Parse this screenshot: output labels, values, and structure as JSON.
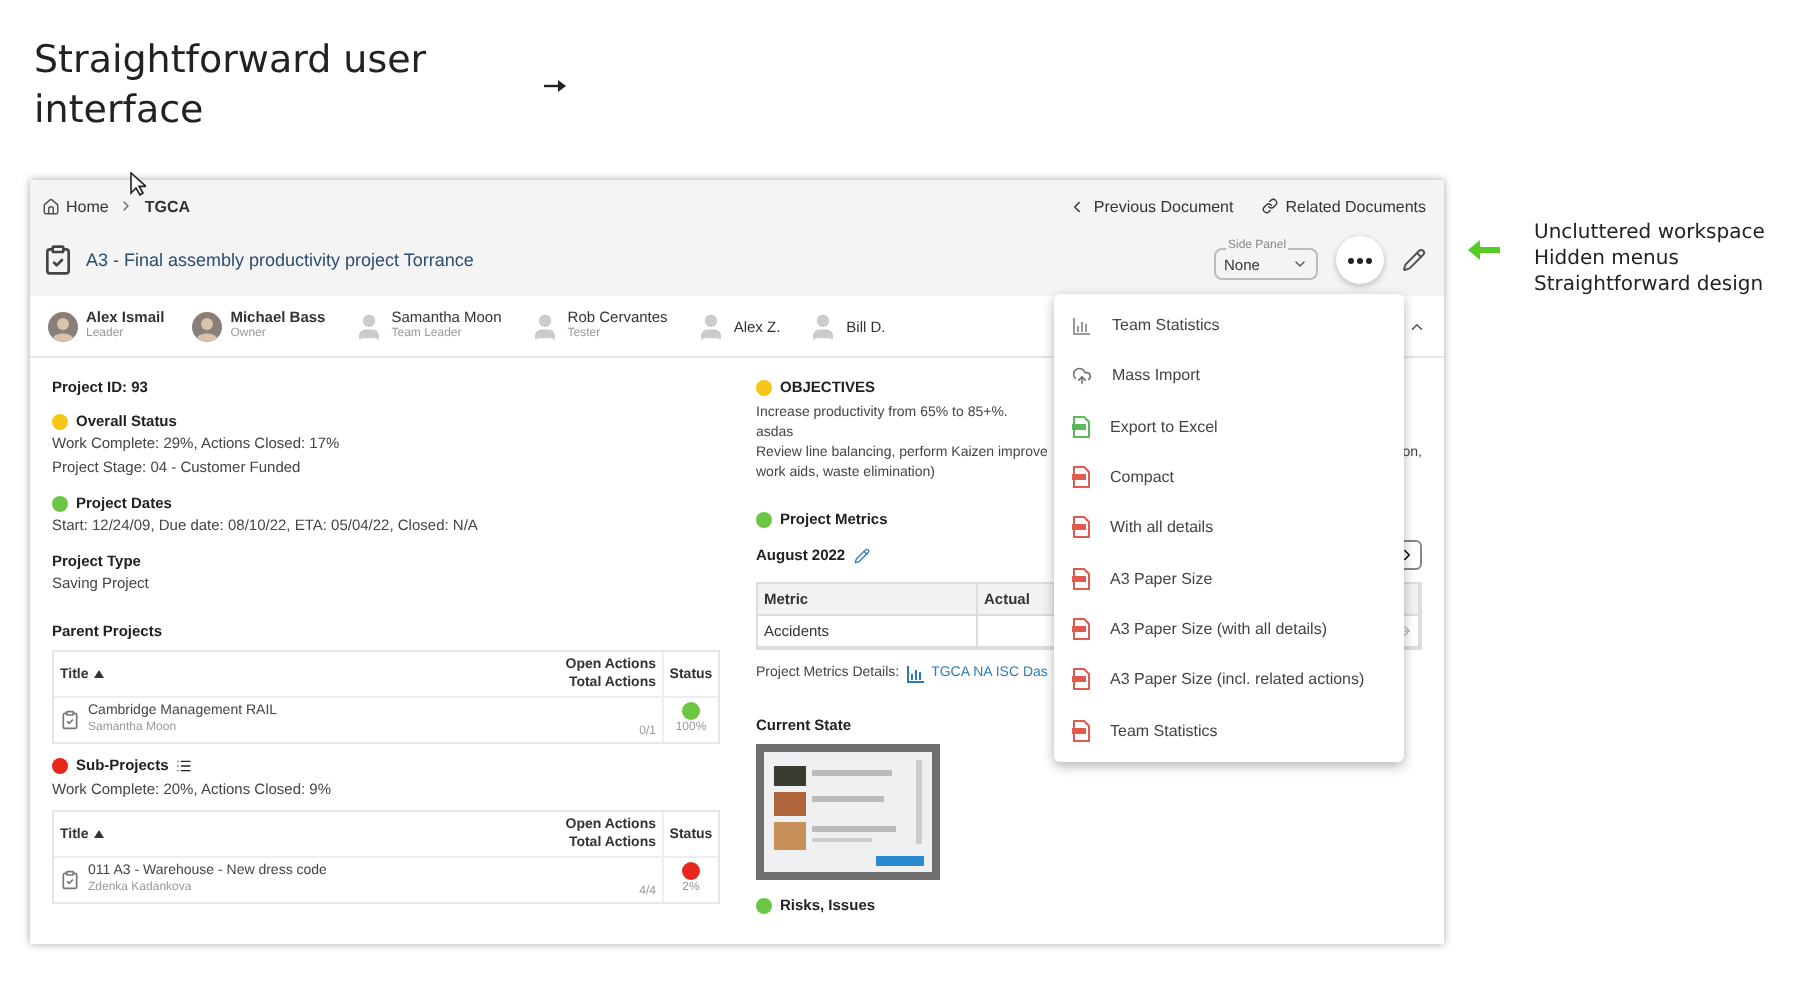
{
  "slide": {
    "heading": "Straightforward user interface",
    "annotation": [
      "Uncluttered workspace",
      "Hidden menus",
      "Straightforward design"
    ]
  },
  "app": {
    "breadcrumbs": [
      {
        "label": "Home",
        "current": false
      },
      {
        "label": "TGCA",
        "current": true
      }
    ],
    "nav_links": [
      {
        "label": "Previous Document",
        "kind": "back"
      },
      {
        "label": "Related Documents",
        "kind": "link"
      }
    ],
    "title": "A3 - Final assembly productivity project Torrance",
    "side_panel": {
      "label": "Side Panel",
      "value": "None"
    },
    "people": [
      {
        "name": "Alex Ismail",
        "role": "Leader"
      },
      {
        "name": "Michael Bass",
        "role": "Owner"
      },
      {
        "name": "Samantha Moon",
        "role": "Team Leader",
        "kind": "placeholder"
      },
      {
        "name": "Rob Cervantes",
        "role": "Tester",
        "kind": "placeholder"
      },
      {
        "name": "Alex Z.",
        "kind": "placeholder"
      },
      {
        "name": "Bill D.",
        "kind": "placeholder"
      }
    ],
    "project_id": "Project ID: 93",
    "sections": [
      {
        "title": "Overall Status",
        "color": "#f5c518",
        "lines": [
          "Work Complete: 29%, Actions Closed: 17%",
          "Project Stage: 04 - Customer Funded"
        ]
      },
      {
        "title": "Project Dates",
        "color": "#6cc644",
        "lines": [
          "Start: 12/24/09, Due date: 08/10/22, ETA: 05/04/22, Closed: N/A"
        ]
      },
      {
        "title": "Project Type",
        "lines": [
          "Saving Project"
        ]
      }
    ],
    "parent_projects": {
      "heading": "Parent Projects",
      "columns": [
        {
          "lines": [
            "Title"
          ],
          "sort_ascending": true
        },
        {
          "lines": [
            "Open Actions",
            "Total Actions"
          ]
        },
        {
          "lines": [
            "Status"
          ]
        }
      ],
      "rows": [
        {
          "title": "Cambridge Management RAIL",
          "owner": "Samantha Moon",
          "actions": "0/1",
          "color": "#6cc644",
          "status": "100%"
        }
      ]
    },
    "sub_projects": {
      "title": "Sub-Projects",
      "color": "#e8261b",
      "lines": [
        "Work Complete: 20%, Actions Closed: 9%"
      ],
      "columns": [
        {
          "lines": [
            "Title"
          ],
          "sort_ascending": true
        },
        {
          "lines": [
            "Open Actions",
            "Total Actions"
          ]
        },
        {
          "lines": [
            "Status"
          ]
        }
      ],
      "rows": [
        {
          "title": "011 A3 - Warehouse - New dress code",
          "owner": "Zdenka Kadankova",
          "actions": "4/4",
          "color": "#e8261b",
          "status": "2%"
        }
      ]
    },
    "objectives": {
      "title": "OBJECTIVES",
      "color": "#f5c518",
      "lines": [
        {
          "text": "Increase productivity from 65% to 85+%."
        },
        {
          "text": "asdas"
        },
        {
          "text": "Review line balancing, perform Kaizen improve",
          "tail": "on,"
        },
        {
          "text": "work aids, waste elimination)"
        }
      ]
    },
    "metrics": {
      "title": "Project Metrics",
      "color": "#6cc644",
      "period": "August 2022",
      "columns": [
        "Metric",
        "Actual"
      ],
      "rows": [
        [
          "Accidents"
        ]
      ],
      "details_label": "Project Metrics Details:",
      "details_link": "TGCA NA ISC Das"
    },
    "current_state": {
      "title": "Current State"
    },
    "risks": {
      "title": "Risks, Issues",
      "color": "#6cc644"
    },
    "menu": [
      {
        "label": "Team Statistics",
        "kind": "chart"
      },
      {
        "label": "Mass Import",
        "kind": "upload"
      },
      {
        "label": "Export to Excel",
        "kind": "excel"
      },
      {
        "label": "Compact",
        "kind": "pdf"
      },
      {
        "label": "With all details",
        "kind": "pdf"
      },
      {
        "label": "A3 Paper Size",
        "kind": "pdf"
      },
      {
        "label": "A3 Paper Size (with all details)",
        "kind": "pdf"
      },
      {
        "label": "A3 Paper Size (incl. related actions)",
        "kind": "pdf"
      },
      {
        "label": "Team Statistics",
        "kind": "pdf"
      }
    ]
  }
}
